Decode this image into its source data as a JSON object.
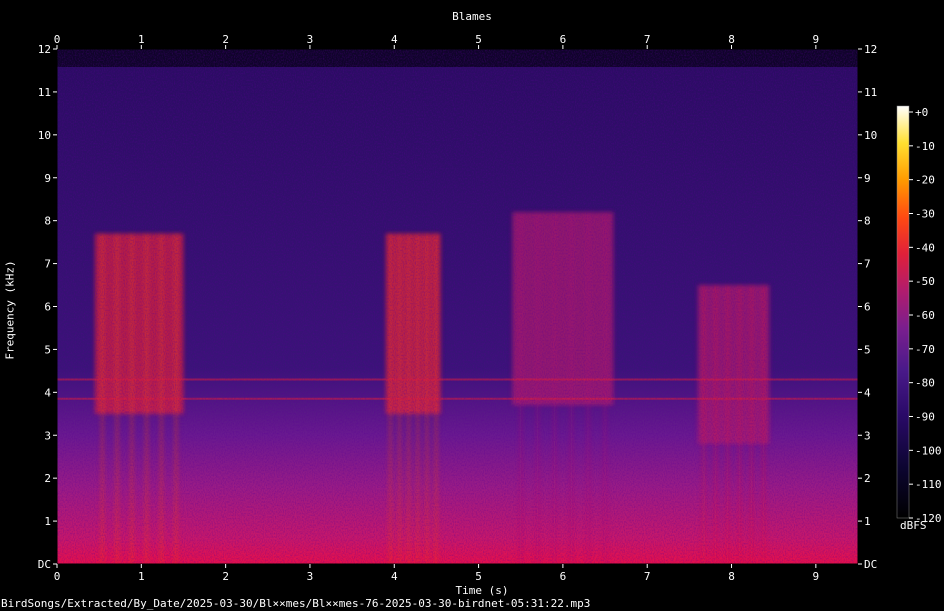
{
  "chart_data": {
    "type": "heatmap",
    "title": "Blames",
    "xlabel": "Time (s)",
    "ylabel": "Frequency (kHz)",
    "xlim": [
      0,
      9.5
    ],
    "ylim": [
      0,
      12
    ],
    "x_ticks": [
      0,
      1,
      2,
      3,
      4,
      5,
      6,
      7,
      8,
      9
    ],
    "y_ticks": [
      "DC",
      "1",
      "2",
      "3",
      "4",
      "5",
      "6",
      "7",
      "8",
      "9",
      "10",
      "11",
      "12"
    ],
    "colorbar": {
      "label": "dBFS",
      "range": [
        -120,
        0
      ],
      "ticks": [
        "+0",
        "-10",
        "-20",
        "-30",
        "-40",
        "-50",
        "-60",
        "-70",
        "-80",
        "-90",
        "-100",
        "-110",
        "-120"
      ],
      "colormap": [
        "#000000",
        "#0c0530",
        "#2a0a68",
        "#4a1a8a",
        "#7a1e8e",
        "#b01c6e",
        "#e0203a",
        "#ff4a12",
        "#ff9a00",
        "#ffe030",
        "#ffffff"
      ]
    },
    "events": [
      {
        "t_start": 0.45,
        "t_end": 1.5,
        "f_low": 3.5,
        "f_high": 7.7,
        "level_db": -45
      },
      {
        "t_start": 3.9,
        "t_end": 4.55,
        "f_low": 3.5,
        "f_high": 7.7,
        "level_db": -45
      },
      {
        "t_start": 5.4,
        "t_end": 6.6,
        "f_low": 3.7,
        "f_high": 8.2,
        "level_db": -65
      },
      {
        "t_start": 7.6,
        "t_end": 8.45,
        "f_low": 2.8,
        "f_high": 6.5,
        "level_db": -60
      }
    ],
    "background_level_db": -95,
    "low_freq_level_db": -55
  },
  "footer": {
    "file_path": "BirdSongs/Extracted/By_Date/2025-03-30/Bl××mes/Bl××mes-76-2025-03-30-birdnet-05:31:22.mp3"
  }
}
